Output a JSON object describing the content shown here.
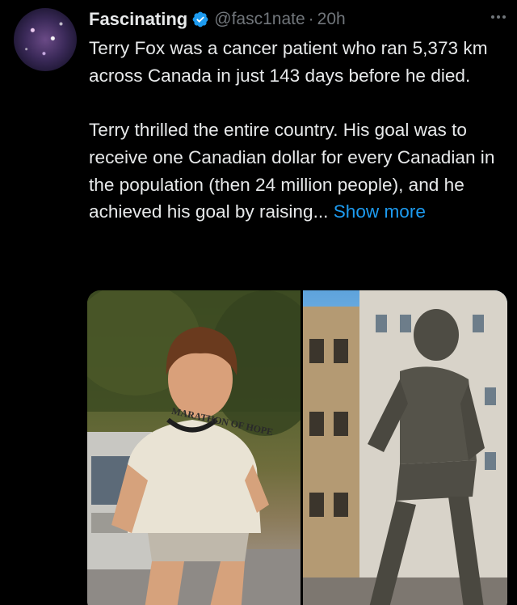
{
  "author": {
    "name": "Fascinating",
    "handle": "@fasc1nate",
    "separator": "·",
    "time": "20h",
    "verified": true
  },
  "tweet": {
    "paragraph1": "Terry Fox was a cancer patient who ran 5,373 km across Canada in just 143 days before he died.",
    "paragraph2": "Terry thrilled the entire country. His goal was to receive one Canadian dollar for every Canadian in the population (then 24 million people), and he achieved his goal by raising...",
    "show_more": "Show more"
  },
  "media": {
    "shirt_text": "MARATHON OF HOPE"
  },
  "colors": {
    "background": "#000000",
    "text": "#e7e9ea",
    "muted": "#71767b",
    "link": "#1d9bf0",
    "verified": "#1d9bf0"
  },
  "icons": {
    "verified": "verified-badge-icon",
    "more": "more-options-icon"
  }
}
